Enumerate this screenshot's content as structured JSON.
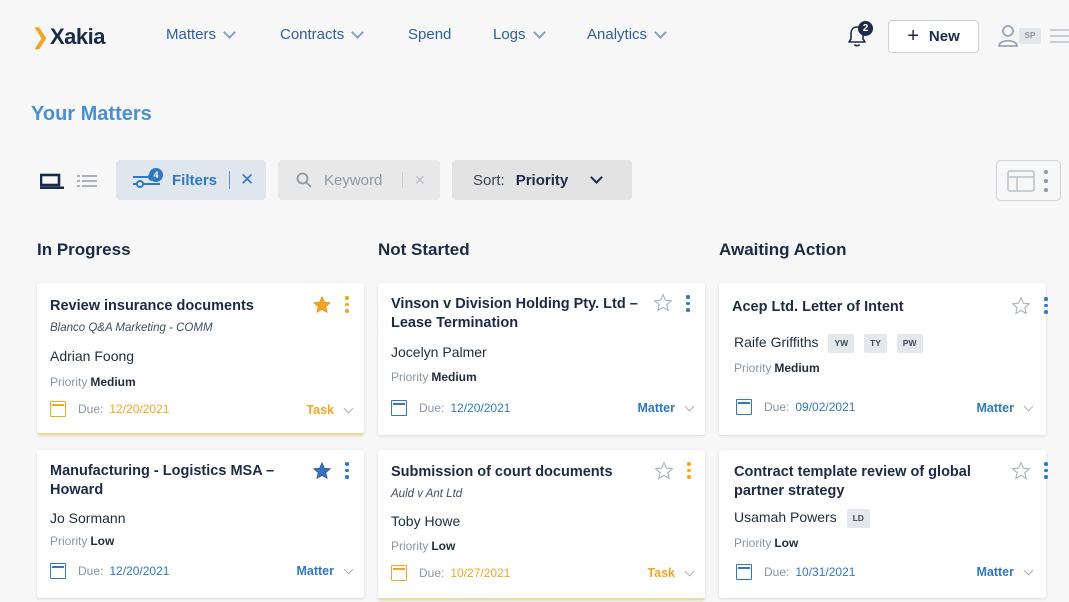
{
  "brand": {
    "logo_mark": "❯",
    "logo_text": "Xakia"
  },
  "nav": [
    {
      "label": "Matters",
      "has_caret": true
    },
    {
      "label": "Contracts",
      "has_caret": true
    },
    {
      "label": "Spend",
      "has_caret": false
    },
    {
      "label": "Logs",
      "has_caret": true
    },
    {
      "label": "Analytics",
      "has_caret": true
    }
  ],
  "header": {
    "notifications_count": "2",
    "new_button_plus": "+",
    "new_button_label": "New",
    "user_initials": "SP"
  },
  "page": {
    "title": "Your Matters"
  },
  "toolbar": {
    "filters_label": "Filters",
    "filters_count": "4",
    "filters_clear": "✕",
    "keyword_placeholder": "Keyword",
    "keyword_value": "",
    "keyword_clear": "✕",
    "sort_label": "Sort:",
    "sort_value": "Priority"
  },
  "columns": [
    {
      "title": "In Progress"
    },
    {
      "title": "Not Started"
    },
    {
      "title": "Awaiting Action"
    }
  ],
  "cards": [
    {
      "title": "Review insurance documents",
      "subtitle": "Blanco Q&A Marketing - COMM",
      "person": "Adrian Foong",
      "priority_label": "Priority",
      "priority": "Medium",
      "due_label": "Due:",
      "due": "12/20/2021",
      "type": "Task",
      "starred": true,
      "star_color": "#f3a523"
    },
    {
      "title": "Manufacturing - Logistics MSA – Howard",
      "subtitle": "",
      "person": "Jo Sormann",
      "priority_label": "Priority",
      "priority": "Low",
      "due_label": "Due:",
      "due": "12/20/2021",
      "type": "Matter",
      "starred": true,
      "star_color": "#3a72c0"
    },
    {
      "title": "Vinson v Division Holding Pty. Ltd – Lease Termination",
      "subtitle": "",
      "person": "Jocelyn Palmer",
      "priority_label": "Priority",
      "priority": "Medium",
      "due_label": "Due:",
      "due": "12/20/2021",
      "type": "Matter",
      "starred": false
    },
    {
      "title": "Submission of court documents",
      "subtitle": "Auld v Ant Ltd",
      "person": "Toby Howe",
      "priority_label": "Priority",
      "priority": "Low",
      "due_label": "Due:",
      "due": "10/27/2021",
      "type": "Task",
      "starred": false
    },
    {
      "title": "Acep Ltd. Letter of Intent",
      "subtitle": "",
      "person": "Raife Griffiths",
      "tags": [
        "YW",
        "TY",
        "PW"
      ],
      "priority_label": "Priority",
      "priority": "Medium",
      "due_label": "Due:",
      "due": "09/02/2021",
      "type": "Matter",
      "starred": false
    },
    {
      "title": "Contract template review of global partner strategy",
      "subtitle": "",
      "person": "Usamah Powers",
      "tags": [
        "LD"
      ],
      "priority_label": "Priority",
      "priority": "Low",
      "due_label": "Due:",
      "due": "10/31/2021",
      "type": "Matter",
      "starred": false
    }
  ],
  "colors": {
    "task": "#f3a523",
    "matter": "#2f78c4",
    "navy": "#1a2b48",
    "title_blue": "#4a8fd6"
  }
}
